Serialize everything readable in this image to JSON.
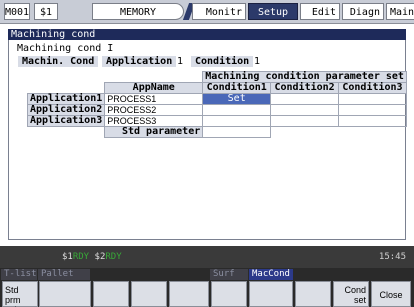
{
  "topbar": {
    "mode": "M001",
    "system": "$1",
    "memory": "MEMORY",
    "tabs": [
      "Monitr",
      "Setup",
      "Edit",
      "Diagn",
      "Mainte"
    ]
  },
  "window": {
    "title": "Machining cond",
    "heading": "Machining cond I",
    "machin_cond_label": "Machin. Cond",
    "application_label": "Application",
    "application_value": "1",
    "condition_label": "Condition",
    "condition_value": "1"
  },
  "table": {
    "group_header": "Machining condition parameter set",
    "appname_header": "AppName",
    "condition_headers": [
      "Condition1",
      "Condition2",
      "Condition3"
    ],
    "rows": [
      {
        "label": "Application1",
        "name": "PROCESS1",
        "cells": [
          "Set",
          "",
          ""
        ]
      },
      {
        "label": "Application2",
        "name": "PROCESS2",
        "cells": [
          "",
          "",
          ""
        ]
      },
      {
        "label": "Application3",
        "name": "PROCESS3",
        "cells": [
          "",
          "",
          ""
        ]
      }
    ],
    "std_param_label": "Std parameter",
    "std_param_value": ""
  },
  "status": {
    "ch1": "$1",
    "rdy1": "RDY",
    "ch2": "$2",
    "rdy2": "RDY",
    "time": "15:45"
  },
  "menu_tabs": [
    "T-list",
    "Pallet",
    "Surf",
    "MacCond"
  ],
  "softkeys": {
    "std_prm_select": "Std prm select",
    "cond_set": "Cond set",
    "close": "Close"
  },
  "colors": {
    "active_tab": "#2c3a6a",
    "selected_cell": "#4a68b8",
    "ready_green": "#38a838"
  }
}
